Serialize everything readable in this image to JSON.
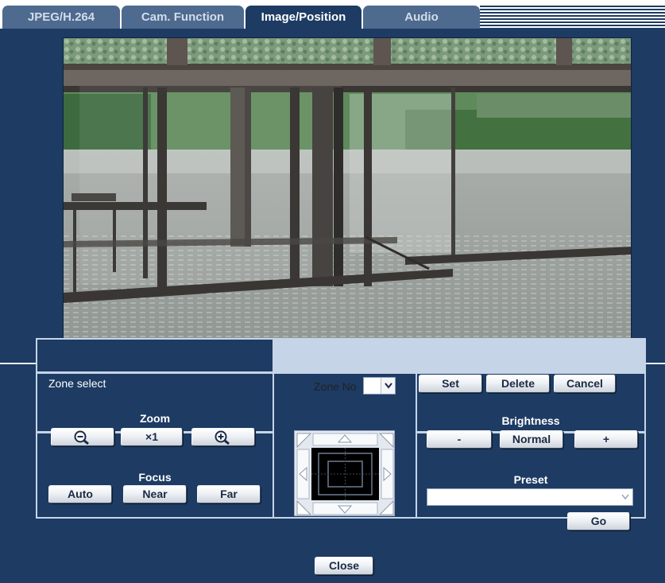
{
  "tabs": [
    {
      "label": "JPEG/H.264",
      "active": false
    },
    {
      "label": "Cam. Function",
      "active": false
    },
    {
      "label": "Image/Position",
      "active": true
    },
    {
      "label": "Audio",
      "active": false
    }
  ],
  "zone": {
    "title": "Zone select",
    "zone_no_label": "Zone No",
    "zone_no_value": "",
    "set_label": "Set",
    "delete_label": "Delete",
    "cancel_label": "Cancel"
  },
  "zoom": {
    "title": "Zoom",
    "x1_label": "×1"
  },
  "focus": {
    "title": "Focus",
    "auto_label": "Auto",
    "near_label": "Near",
    "far_label": "Far"
  },
  "brightness": {
    "title": "Brightness",
    "minus_label": "-",
    "normal_label": "Normal",
    "plus_label": "+"
  },
  "preset": {
    "title": "Preset",
    "selected": "",
    "go_label": "Go"
  },
  "close_label": "Close",
  "colors": {
    "panel": "#1d3b63",
    "tab_inactive": "#4e6a8e",
    "control_border": "#c6d4e8"
  }
}
